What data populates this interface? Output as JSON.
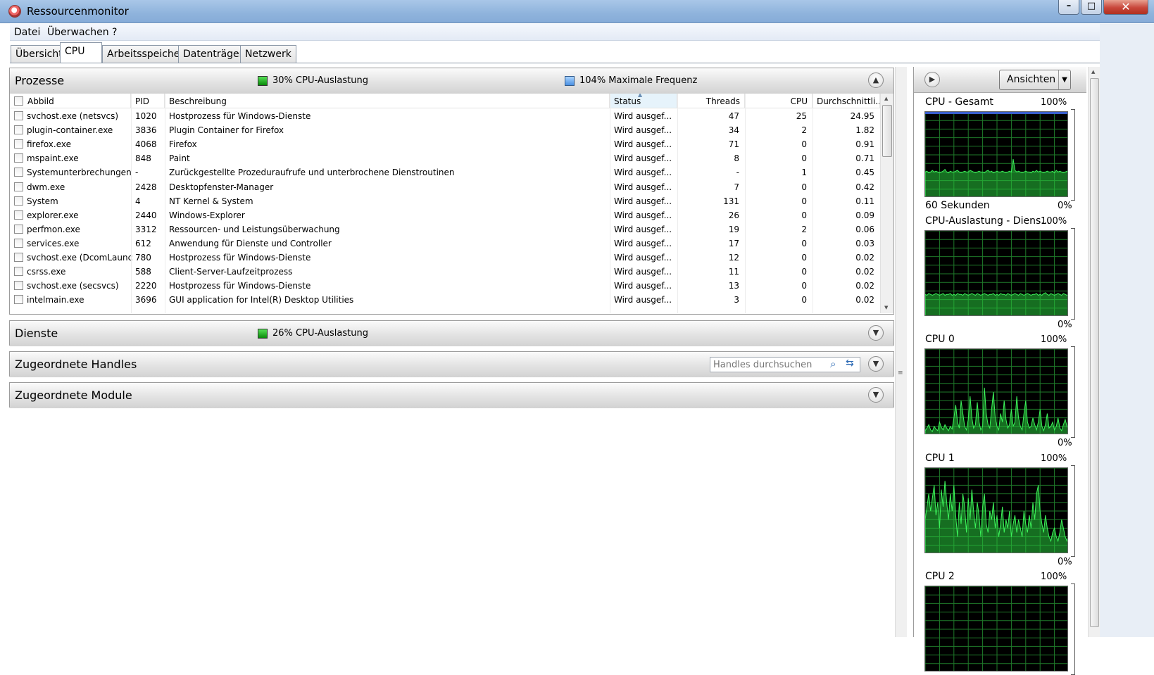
{
  "window": {
    "title": "Ressourcenmonitor"
  },
  "menu": [
    "Datei",
    "Überwachen",
    "?"
  ],
  "tabs": [
    {
      "label": "Übersicht",
      "active": false
    },
    {
      "label": "CPU",
      "active": true
    },
    {
      "label": "Arbeitsspeicher",
      "active": false
    },
    {
      "label": "Datenträger",
      "active": false
    },
    {
      "label": "Netzwerk",
      "active": false
    }
  ],
  "prozesse": {
    "title": "Prozesse",
    "cpu_usage": "30% CPU-Auslastung",
    "max_freq": "104% Maximale Frequenz",
    "columns": [
      "Abbild",
      "PID",
      "Beschreibung",
      "Status",
      "Threads",
      "CPU",
      "Durchschnittli..."
    ],
    "rows": [
      {
        "image": "svchost.exe (netsvcs)",
        "pid": "1020",
        "desc": "Hostprozess für Windows-Dienste",
        "status": "Wird ausgef...",
        "threads": "47",
        "cpu": "25",
        "avg": "24.95"
      },
      {
        "image": "plugin-container.exe",
        "pid": "3836",
        "desc": "Plugin Container for Firefox",
        "status": "Wird ausgef...",
        "threads": "34",
        "cpu": "2",
        "avg": "1.82"
      },
      {
        "image": "firefox.exe",
        "pid": "4068",
        "desc": "Firefox",
        "status": "Wird ausgef...",
        "threads": "71",
        "cpu": "0",
        "avg": "0.91"
      },
      {
        "image": "mspaint.exe",
        "pid": "848",
        "desc": "Paint",
        "status": "Wird ausgef...",
        "threads": "8",
        "cpu": "0",
        "avg": "0.71"
      },
      {
        "image": "Systemunterbrechungen",
        "pid": "-",
        "desc": "Zurückgestellte Prozeduraufrufe und unterbrochene Dienstroutinen",
        "status": "Wird ausgef...",
        "threads": "-",
        "cpu": "1",
        "avg": "0.45"
      },
      {
        "image": "dwm.exe",
        "pid": "2428",
        "desc": "Desktopfenster-Manager",
        "status": "Wird ausgef...",
        "threads": "7",
        "cpu": "0",
        "avg": "0.42"
      },
      {
        "image": "System",
        "pid": "4",
        "desc": "NT Kernel & System",
        "status": "Wird ausgef...",
        "threads": "131",
        "cpu": "0",
        "avg": "0.11"
      },
      {
        "image": "explorer.exe",
        "pid": "2440",
        "desc": "Windows-Explorer",
        "status": "Wird ausgef...",
        "threads": "26",
        "cpu": "0",
        "avg": "0.09"
      },
      {
        "image": "perfmon.exe",
        "pid": "3312",
        "desc": "Ressourcen- und Leistungsüberwachung",
        "status": "Wird ausgef...",
        "threads": "19",
        "cpu": "2",
        "avg": "0.06"
      },
      {
        "image": "services.exe",
        "pid": "612",
        "desc": "Anwendung für Dienste und Controller",
        "status": "Wird ausgef...",
        "threads": "17",
        "cpu": "0",
        "avg": "0.03"
      },
      {
        "image": "svchost.exe (DcomLaunc...",
        "pid": "780",
        "desc": "Hostprozess für Windows-Dienste",
        "status": "Wird ausgef...",
        "threads": "12",
        "cpu": "0",
        "avg": "0.02"
      },
      {
        "image": "csrss.exe",
        "pid": "588",
        "desc": "Client-Server-Laufzeitprozess",
        "status": "Wird ausgef...",
        "threads": "11",
        "cpu": "0",
        "avg": "0.02"
      },
      {
        "image": "svchost.exe (secsvcs)",
        "pid": "2220",
        "desc": "Hostprozess für Windows-Dienste",
        "status": "Wird ausgef...",
        "threads": "13",
        "cpu": "0",
        "avg": "0.02"
      },
      {
        "image": "intelmain.exe",
        "pid": "3696",
        "desc": "GUI application for Intel(R) Desktop Utilities",
        "status": "Wird ausgef...",
        "threads": "3",
        "cpu": "0",
        "avg": "0.02"
      }
    ]
  },
  "dienste": {
    "title": "Dienste",
    "cpu_usage": "26% CPU-Auslastung"
  },
  "handles": {
    "title": "Zugeordnete Handles",
    "search_placeholder": "Handles durchsuchen"
  },
  "module": {
    "title": "Zugeordnete Module"
  },
  "right": {
    "views_label": "Ansichten",
    "graphs": [
      {
        "title": "CPU - Gesamt",
        "top": "100%",
        "bottom_left": "60 Sekunden",
        "bottom": "0%",
        "values": [
          30,
          31,
          29,
          30,
          32,
          30,
          31,
          30,
          29,
          30,
          31,
          33,
          30,
          29,
          31,
          30,
          30,
          31,
          32,
          30,
          29,
          30,
          31,
          30,
          30,
          32,
          31,
          30,
          29,
          30,
          31,
          30,
          30,
          29,
          31,
          32,
          30,
          31,
          29,
          30,
          31,
          30,
          30,
          31,
          30,
          29,
          30,
          31,
          30,
          45,
          32,
          30,
          31,
          30,
          29,
          30,
          31,
          30,
          30,
          29,
          31,
          30,
          32,
          30,
          31,
          30,
          29,
          30,
          31,
          30,
          30,
          31,
          29,
          32,
          30,
          31,
          30,
          29,
          30,
          31,
          30
        ]
      },
      {
        "title": "CPU-Auslastung - Diens...",
        "top": "100%",
        "bottom_left": "",
        "bottom": "0%",
        "values": [
          26,
          25,
          27,
          26,
          25,
          26,
          27,
          26,
          25,
          26,
          27,
          25,
          26,
          26,
          27,
          25,
          26,
          25,
          27,
          26,
          26,
          25,
          27,
          26,
          25,
          26,
          27,
          26,
          25,
          27,
          26,
          25,
          26,
          27,
          26,
          25,
          26,
          26,
          27,
          25,
          26,
          25,
          27,
          26,
          26,
          25,
          27,
          26,
          25,
          26,
          27,
          26,
          25,
          27,
          26,
          25,
          26,
          27,
          26,
          25,
          26,
          26,
          27,
          25,
          26,
          25,
          27,
          28,
          26,
          25,
          27,
          26,
          25,
          26,
          27,
          26,
          25,
          27,
          26,
          25,
          26
        ]
      },
      {
        "title": "CPU 0",
        "top": "100%",
        "bottom_left": "",
        "bottom": "0%",
        "values": [
          5,
          8,
          12,
          6,
          4,
          10,
          7,
          5,
          15,
          9,
          6,
          12,
          8,
          5,
          10,
          7,
          20,
          35,
          15,
          8,
          40,
          25,
          10,
          6,
          18,
          45,
          20,
          8,
          12,
          38,
          15,
          6,
          10,
          55,
          25,
          12,
          8,
          30,
          50,
          20,
          10,
          6,
          25,
          15,
          40,
          18,
          8,
          12,
          30,
          10,
          15,
          45,
          20,
          10,
          6,
          25,
          40,
          15,
          8,
          10,
          20,
          12,
          6,
          15,
          30,
          10,
          5,
          12,
          25,
          8,
          10,
          15,
          6,
          10,
          20,
          8,
          5,
          12,
          18,
          10,
          6
        ]
      },
      {
        "title": "CPU 1",
        "top": "100%",
        "bottom_left": "",
        "bottom": "0%",
        "values": [
          40,
          55,
          70,
          50,
          65,
          80,
          45,
          60,
          30,
          75,
          55,
          85,
          60,
          40,
          70,
          50,
          80,
          45,
          20,
          60,
          35,
          70,
          55,
          25,
          65,
          40,
          75,
          50,
          30,
          60,
          45,
          20,
          55,
          70,
          35,
          25,
          50,
          40,
          60,
          30,
          45,
          20,
          35,
          55,
          25,
          40,
          30,
          50,
          20,
          35,
          45,
          25,
          40,
          30,
          20,
          50,
          35,
          25,
          45,
          30,
          60,
          40,
          70,
          80,
          50,
          35,
          25,
          45,
          30,
          20,
          15,
          25,
          30,
          20,
          15,
          25,
          40,
          30,
          20,
          15,
          25
        ]
      },
      {
        "title": "CPU 2",
        "top": "100%",
        "bottom_left": "",
        "bottom": "",
        "values": []
      }
    ]
  }
}
